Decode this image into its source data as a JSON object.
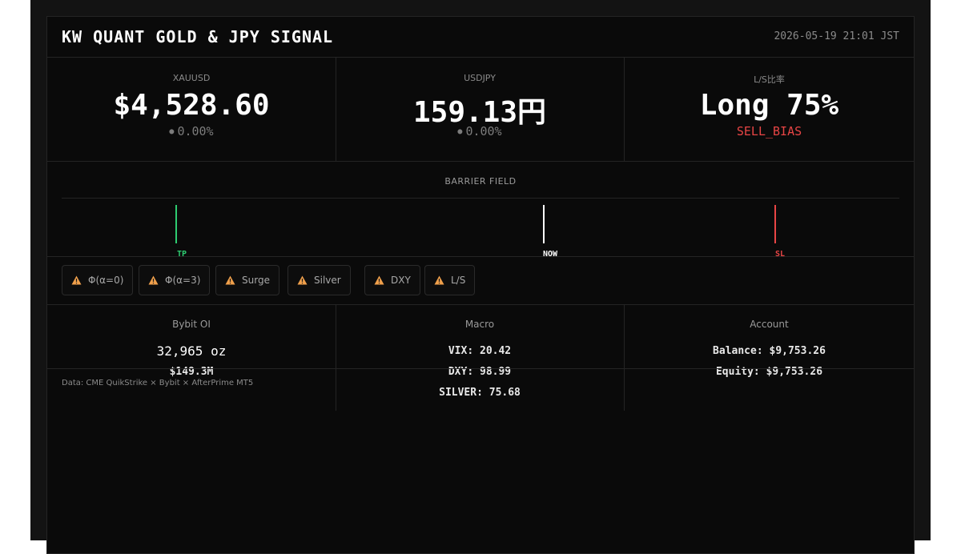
{
  "header": {
    "title": "KW QUANT GOLD & JPY SIGNAL",
    "timestamp": "2026-05-19 21:01 JST"
  },
  "metrics": [
    {
      "label": "XAUUSD",
      "value": "$4,528.60",
      "change": "0.00%"
    },
    {
      "label": "USDJPY",
      "value": "159.13円",
      "change": "0.00%"
    },
    {
      "label": "L/S比率",
      "value": "Long 75%",
      "bias": "SELL_BIAS"
    }
  ],
  "barrier": {
    "title": "BARRIER FIELD",
    "markers": [
      {
        "label": "TP",
        "color": "#2ecc71"
      },
      {
        "label": "NOW",
        "color": "#ffffff"
      },
      {
        "label": "SL",
        "color": "#e84545"
      }
    ]
  },
  "alerts": [
    {
      "label": "Φ(α=0)",
      "icon": "warning-icon"
    },
    {
      "label": "Φ(α=3)",
      "icon": "warning-icon"
    },
    {
      "label": "Surge",
      "icon": "warning-icon"
    },
    {
      "label": "Silver",
      "icon": "warning-icon"
    },
    {
      "label": "DXY",
      "icon": "warning-icon"
    },
    {
      "label": "L/S",
      "icon": "warning-icon"
    }
  ],
  "bybit": {
    "title": "Bybit OI",
    "oi": "32,965 oz",
    "notional": "$149.3M"
  },
  "macro": {
    "title": "Macro",
    "vix": "VIX: 20.42",
    "dxy": "DXY: 98.99",
    "silver": "SILVER: 75.68"
  },
  "account": {
    "title": "Account",
    "balance": "Balance: $9,753.26",
    "equity": "Equity: $9,753.26"
  },
  "footer": {
    "source": "Data: CME QuikStrike × Bybit × AfterPrime MT5"
  },
  "colors": {
    "background": "#0a0a0a",
    "warning": "#f0a04b",
    "sell_bias": "#e84545",
    "tp": "#2ecc71",
    "sl": "#e84545"
  }
}
